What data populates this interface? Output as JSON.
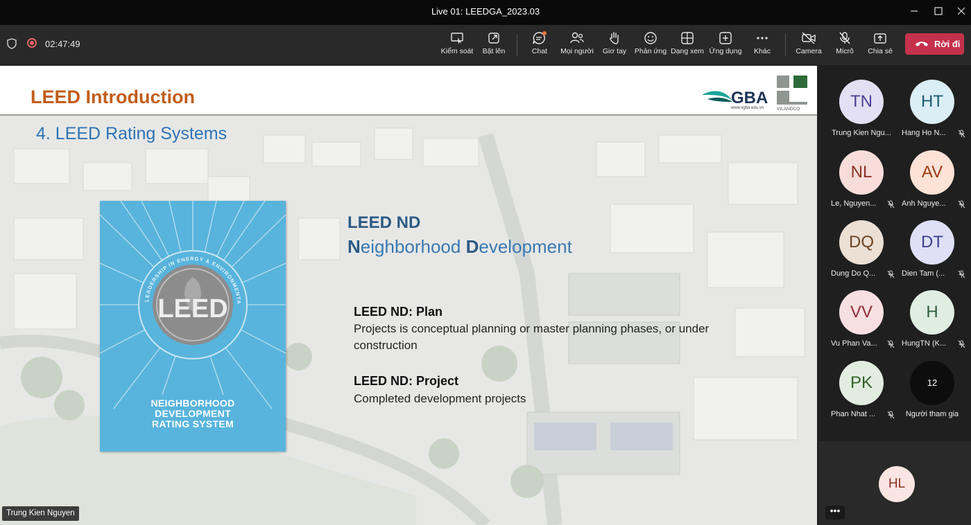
{
  "window": {
    "title": "Live 01: LEEDGA_2023.03"
  },
  "toolbar": {
    "timer": "02:47:49",
    "buttons": [
      {
        "label": "Kiểm soát",
        "icon": "control-icon"
      },
      {
        "label": "Bật lên",
        "icon": "popout-icon"
      },
      {
        "label": "Chat",
        "icon": "chat-icon"
      },
      {
        "label": "Mọi người",
        "icon": "people-icon"
      },
      {
        "label": "Giơ tay",
        "icon": "hand-icon"
      },
      {
        "label": "Phản ứng",
        "icon": "reaction-icon"
      },
      {
        "label": "Dạng xem",
        "icon": "view-icon"
      },
      {
        "label": "Ứng dụng",
        "icon": "apps-icon"
      },
      {
        "label": "Khác",
        "icon": "more-icon"
      },
      {
        "label": "Camera",
        "icon": "camera-off-icon"
      },
      {
        "label": "Micrô",
        "icon": "mic-off-icon"
      },
      {
        "label": "Chia sẻ",
        "icon": "share-icon"
      }
    ],
    "leave_label": "Rời đi"
  },
  "slide": {
    "title": "LEED Introduction",
    "logo_gba": "GBA",
    "logo_gba_url": "www.vgba.edu.vn",
    "logo_vilandco": "VILANDCO",
    "subtitle": "4. LEED Rating Systems",
    "book": {
      "badge_ring_text": "LEADERSHIP IN ENERGY & ENVIRONMENTAL DESIGN",
      "badge": "LEED",
      "line1": "NEIGHBORHOOD",
      "line2": "DEVELOPMENT",
      "line3": "RATING SYSTEM"
    },
    "nd_title": "LEED ND",
    "nd_sub": {
      "n": "N",
      "eighborhood": "eighborhood ",
      "d": "D",
      "evelopment": "evelopment"
    },
    "items": [
      {
        "heading": "LEED ND: Plan",
        "text": "Projects is conceptual planning or master planning phases, or under construction"
      },
      {
        "heading": "LEED ND: Project",
        "text": "Completed development projects"
      }
    ],
    "presenter": "Trung Kien Nguyen"
  },
  "participants": [
    {
      "initials": "TN",
      "name": "Trung Kien Ngu...",
      "muted": false,
      "bg": "#e3e0f4",
      "fg": "#4a3f8f"
    },
    {
      "initials": "HT",
      "name": "Hang Ho N...",
      "muted": true,
      "bg": "#dbeef5",
      "fg": "#1d5a73"
    },
    {
      "initials": "NL",
      "name": "Le, Nguyen...",
      "muted": true,
      "bg": "#f6ddd9",
      "fg": "#8a3226"
    },
    {
      "initials": "AV",
      "name": "Anh Nguye...",
      "muted": true,
      "bg": "#fde2d6",
      "fg": "#9a3b12"
    },
    {
      "initials": "DQ",
      "name": "Dung Do Q...",
      "muted": true,
      "bg": "#ecdfd4",
      "fg": "#6b4426"
    },
    {
      "initials": "DT",
      "name": "Dien Tam (...",
      "muted": true,
      "bg": "#dfe0f7",
      "fg": "#3c3f8f"
    },
    {
      "initials": "VV",
      "name": "Vu Phan Va...",
      "muted": true,
      "bg": "#f8dfe1",
      "fg": "#8c2d39"
    },
    {
      "initials": "H",
      "name": "HungTN (K...",
      "muted": true,
      "bg": "#e0eee2",
      "fg": "#2f5e3a"
    },
    {
      "initials": "PK",
      "name": "Phan Nhat ...",
      "muted": true,
      "bg": "#e1eedf",
      "fg": "#335e2a"
    },
    {
      "initials": "12",
      "name": "Người tham gia",
      "muted": false,
      "bg": "#0d0d0d",
      "fg": "#ffffff"
    }
  ],
  "self": {
    "initials": "HL",
    "more": "•••"
  },
  "colors": {
    "leave": "#c4314b",
    "title_orange": "#c25e1a",
    "subtitle_blue": "#2e72b5"
  }
}
